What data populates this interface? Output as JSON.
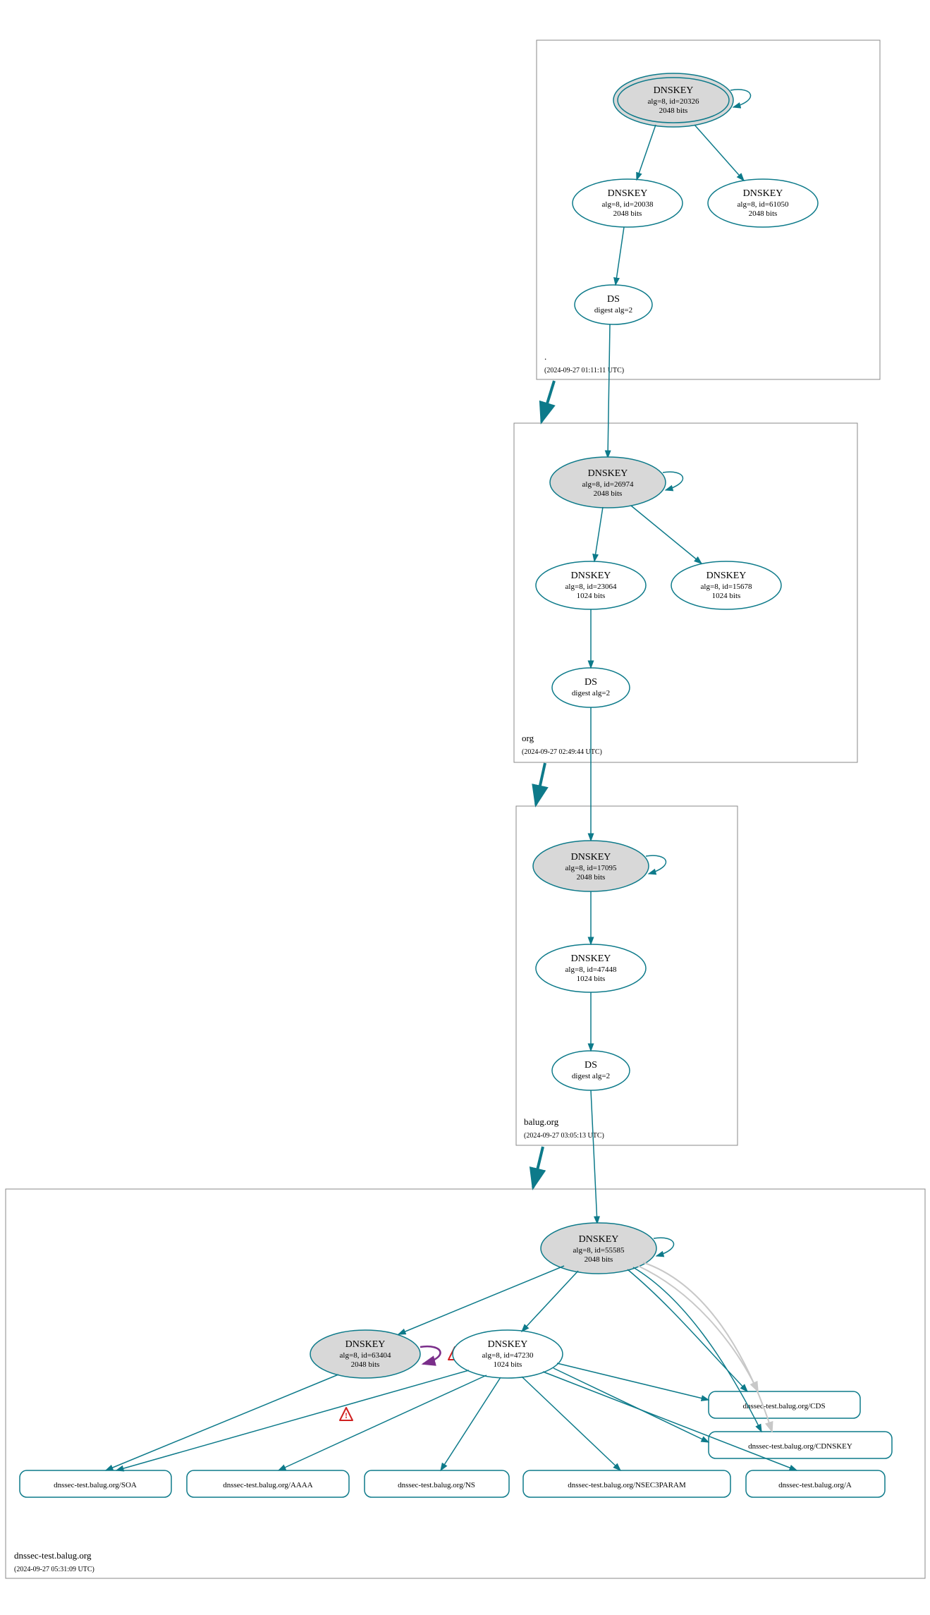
{
  "chart_data": {
    "type": "diagram",
    "zones": [
      {
        "name": ".",
        "timestamp": "(2024-09-27 01:11:11 UTC)",
        "ksk": {
          "label": "DNSKEY",
          "alg": "alg=8, id=20326",
          "bits": "2048 bits"
        },
        "zsk": [
          {
            "label": "DNSKEY",
            "alg": "alg=8, id=20038",
            "bits": "2048 bits"
          },
          {
            "label": "DNSKEY",
            "alg": "alg=8, id=61050",
            "bits": "2048 bits"
          }
        ],
        "ds": {
          "label": "DS",
          "alg": "digest alg=2"
        }
      },
      {
        "name": "org",
        "timestamp": "(2024-09-27 02:49:44 UTC)",
        "ksk": {
          "label": "DNSKEY",
          "alg": "alg=8, id=26974",
          "bits": "2048 bits"
        },
        "zsk": [
          {
            "label": "DNSKEY",
            "alg": "alg=8, id=23064",
            "bits": "1024 bits"
          },
          {
            "label": "DNSKEY",
            "alg": "alg=8, id=15678",
            "bits": "1024 bits"
          }
        ],
        "ds": {
          "label": "DS",
          "alg": "digest alg=2"
        }
      },
      {
        "name": "balug.org",
        "timestamp": "(2024-09-27 03:05:13 UTC)",
        "ksk": {
          "label": "DNSKEY",
          "alg": "alg=8, id=17095",
          "bits": "2048 bits"
        },
        "zsk": [
          {
            "label": "DNSKEY",
            "alg": "alg=8, id=47448",
            "bits": "1024 bits"
          }
        ],
        "ds": {
          "label": "DS",
          "alg": "digest alg=2"
        }
      },
      {
        "name": "dnssec-test.balug.org",
        "timestamp": "(2024-09-27 05:31:09 UTC)",
        "ksk": {
          "label": "DNSKEY",
          "alg": "alg=8, id=55585",
          "bits": "2048 bits"
        },
        "zsk": [
          {
            "label": "DNSKEY",
            "alg": "alg=8, id=63404",
            "bits": "2048 bits",
            "grey": true,
            "warn": true
          },
          {
            "label": "DNSKEY",
            "alg": "alg=8, id=47230",
            "bits": "1024 bits"
          }
        ],
        "rrsets": [
          "dnssec-test.balug.org/SOA",
          "dnssec-test.balug.org/AAAA",
          "dnssec-test.balug.org/NS",
          "dnssec-test.balug.org/NSEC3PARAM",
          "dnssec-test.balug.org/A",
          "dnssec-test.balug.org/CDS",
          "dnssec-test.balug.org/CDNSKEY"
        ]
      }
    ]
  }
}
